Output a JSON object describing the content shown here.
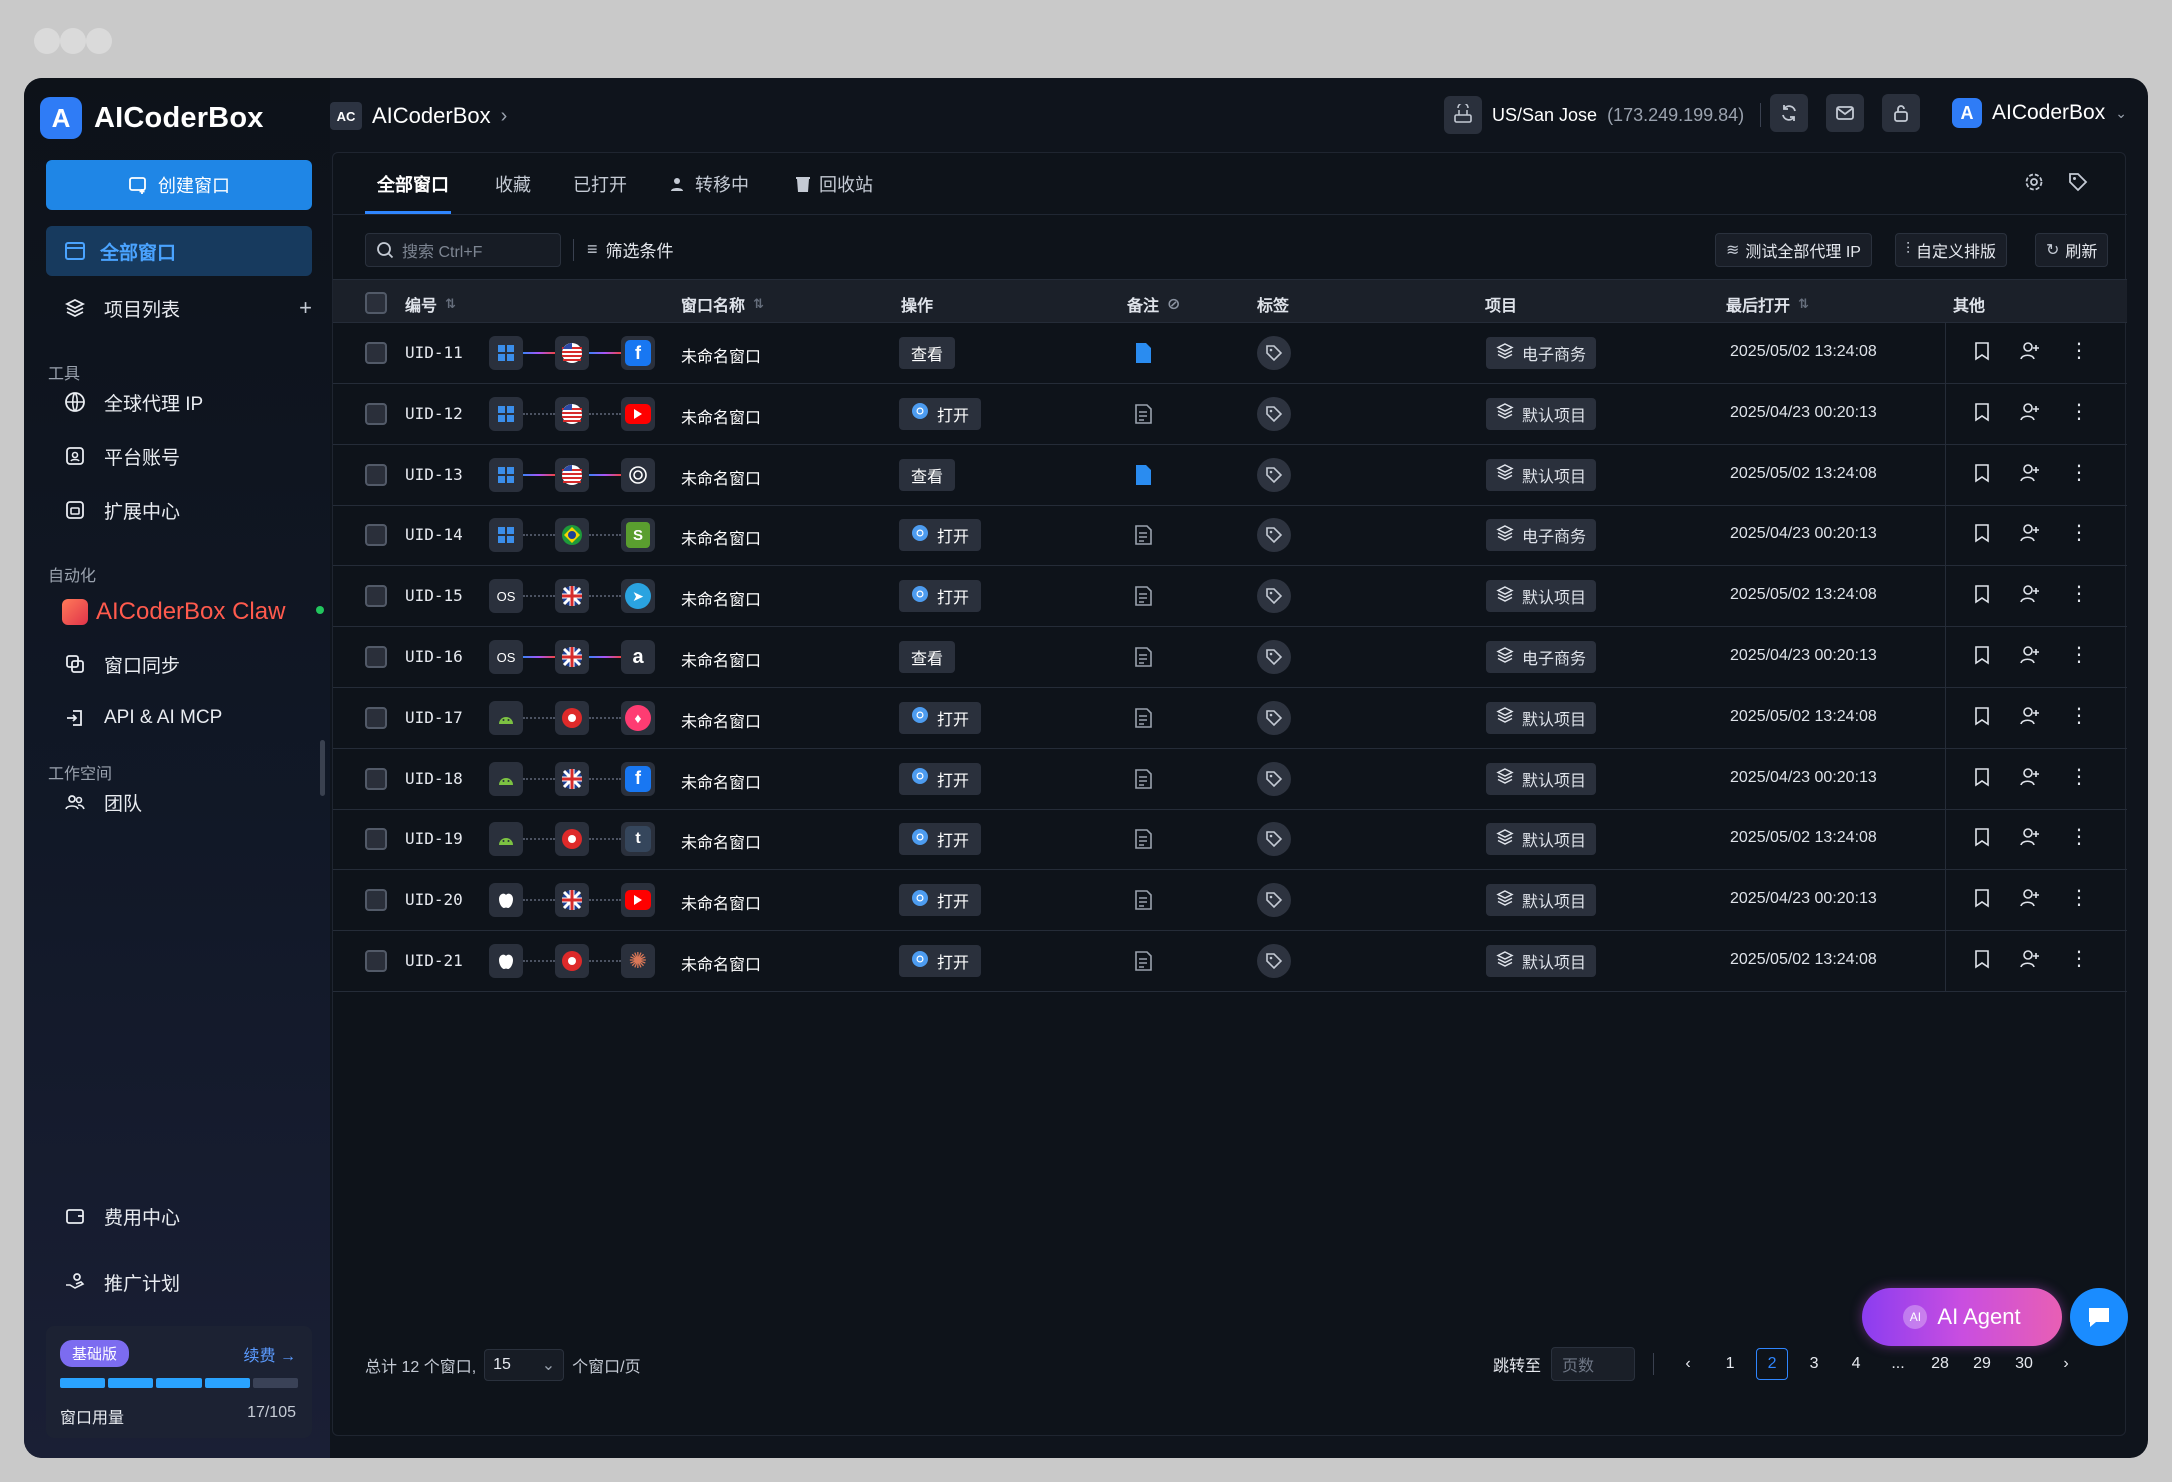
{
  "app": {
    "name": "AICoderBox",
    "logo_letter": "A"
  },
  "sidebar": {
    "create_label": "创建窗口",
    "active_label": "全部窗口",
    "project_list": "项目列表",
    "section_tools": "工具",
    "proxy": "全球代理 IP",
    "accounts": "平台账号",
    "extensions": "扩展中心",
    "section_automation": "自动化",
    "claw": "AICoderBox Claw",
    "sync": "窗口同步",
    "api": "API & AI MCP",
    "section_workspace": "工作空间",
    "team": "团队",
    "billing": "费用中心",
    "promo": "推广计划",
    "plan": {
      "badge": "基础版",
      "renew": "续费",
      "usage_label": "窗口用量",
      "usage_value": "17/105"
    }
  },
  "topbar": {
    "crumb_badge": "AC",
    "crumb_title": "AICoderBox",
    "location": "US/San Jose",
    "ip": "(173.249.199.84)",
    "user_letter": "A",
    "user_name": "AICoderBox"
  },
  "tabs": {
    "all": "全部窗口",
    "fav": "收藏",
    "opened": "已打开",
    "transfer": "转移中",
    "trash": "回收站"
  },
  "toolbar": {
    "search_placeholder": "搜索  Ctrl+F",
    "filter": "筛选条件",
    "test_proxy": "测试全部代理 IP",
    "custom_sort": "自定义排版",
    "refresh": "刷新"
  },
  "table": {
    "headers": {
      "id": "编号",
      "name": "窗口名称",
      "op": "操作",
      "note": "备注",
      "tag": "标签",
      "project": "项目",
      "last": "最后打开",
      "other": "其他"
    },
    "rows": [
      {
        "uid": "UID-11",
        "os": "windows",
        "flag": "us",
        "app": "facebook",
        "link": "grad",
        "name": "未命名窗口",
        "op": "查看",
        "op_icon": false,
        "note": "filled",
        "project": "电子商务",
        "last": "2025/05/02 13:24:08"
      },
      {
        "uid": "UID-12",
        "os": "windows",
        "flag": "us",
        "app": "youtube",
        "link": "dashed",
        "name": "未命名窗口",
        "op": "打开",
        "op_icon": true,
        "note": "outline",
        "project": "默认项目",
        "last": "2025/04/23 00:20:13"
      },
      {
        "uid": "UID-13",
        "os": "windows",
        "flag": "us",
        "app": "openai",
        "link": "grad",
        "name": "未命名窗口",
        "op": "查看",
        "op_icon": false,
        "note": "filled",
        "project": "默认项目",
        "last": "2025/05/02 13:24:08"
      },
      {
        "uid": "UID-14",
        "os": "windows",
        "flag": "br",
        "app": "shopify",
        "link": "dashed",
        "name": "未命名窗口",
        "op": "打开",
        "op_icon": true,
        "note": "outline",
        "project": "电子商务",
        "last": "2025/04/23 00:20:13"
      },
      {
        "uid": "UID-15",
        "os": "macos",
        "flag": "uk",
        "app": "telegram",
        "link": "dashed",
        "name": "未命名窗口",
        "op": "打开",
        "op_icon": true,
        "note": "outline",
        "project": "默认项目",
        "last": "2025/05/02 13:24:08"
      },
      {
        "uid": "UID-16",
        "os": "macos",
        "flag": "uk",
        "app": "amazon",
        "link": "grad",
        "name": "未命名窗口",
        "op": "查看",
        "op_icon": false,
        "note": "outline",
        "project": "电子商务",
        "last": "2025/04/23 00:20:13"
      },
      {
        "uid": "UID-17",
        "os": "android",
        "flag": "hk",
        "app": "tinder",
        "link": "dashed",
        "name": "未命名窗口",
        "op": "打开",
        "op_icon": true,
        "note": "outline",
        "project": "默认项目",
        "last": "2025/05/02 13:24:08"
      },
      {
        "uid": "UID-18",
        "os": "android",
        "flag": "uk",
        "app": "facebook",
        "link": "dashed",
        "name": "未命名窗口",
        "op": "打开",
        "op_icon": true,
        "note": "outline",
        "project": "默认项目",
        "last": "2025/04/23 00:20:13"
      },
      {
        "uid": "UID-19",
        "os": "android",
        "flag": "hk",
        "app": "tumblr",
        "link": "dashed",
        "name": "未命名窗口",
        "op": "打开",
        "op_icon": true,
        "note": "outline",
        "project": "默认项目",
        "last": "2025/05/02 13:24:08"
      },
      {
        "uid": "UID-20",
        "os": "apple",
        "flag": "uk",
        "app": "youtube",
        "link": "dashed",
        "name": "未命名窗口",
        "op": "打开",
        "op_icon": true,
        "note": "outline",
        "project": "默认项目",
        "last": "2025/04/23 00:20:13"
      },
      {
        "uid": "UID-21",
        "os": "apple",
        "flag": "hk",
        "app": "claude",
        "link": "dashed",
        "name": "未命名窗口",
        "op": "打开",
        "op_icon": true,
        "note": "outline",
        "project": "默认项目",
        "last": "2025/05/02 13:24:08"
      }
    ]
  },
  "footer": {
    "total": "总计 12 个窗口,",
    "per_value": "15",
    "per_label": "个窗口/页",
    "goto": "跳转至",
    "page_placeholder": "页数",
    "pages": [
      "1",
      "2",
      "3",
      "4",
      "...",
      "28",
      "29",
      "30"
    ],
    "current_page": "2"
  },
  "agent": {
    "label": "AI Agent",
    "badge": "AI"
  },
  "colors": {
    "accent": "#2f86ff",
    "claw": "#ff5a4d",
    "bg": "#0f141c"
  }
}
